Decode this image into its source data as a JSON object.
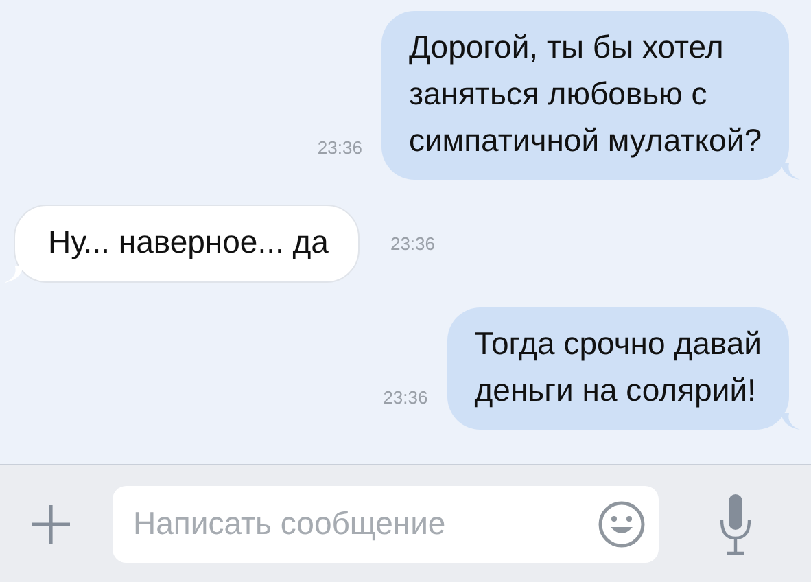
{
  "messages": [
    {
      "kind": "out",
      "text": "Дорогой, ты бы хотел\nзаняться любовью с\nсимпатичной мулаткой?",
      "time": "23:36"
    },
    {
      "kind": "in",
      "text": "Ну... наверное... да",
      "time": "23:36"
    },
    {
      "kind": "out",
      "text": "Тогда срочно давай\nденьги на солярий!",
      "time": "23:36"
    }
  ],
  "composer": {
    "placeholder": "Написать сообщение"
  }
}
